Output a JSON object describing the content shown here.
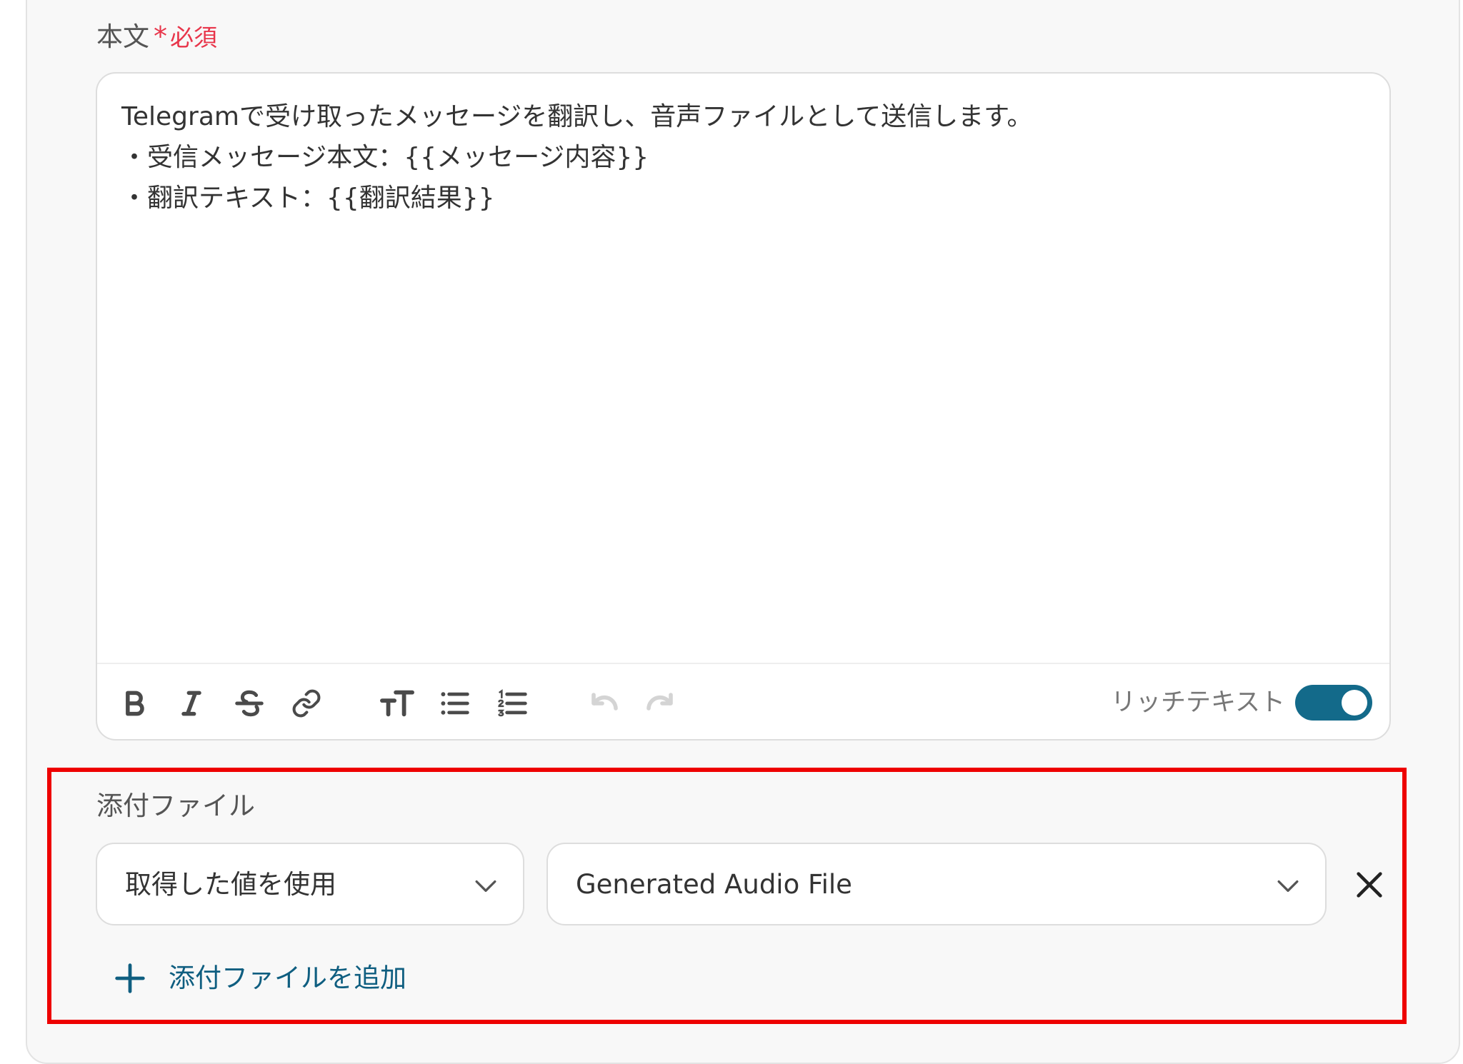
{
  "body_field": {
    "label": "本文",
    "required_mark": "*",
    "required_text": "必須",
    "lines": [
      "Telegramで受け取ったメッセージを翻訳し、音声ファイルとして送信します。",
      "・受信メッセージ本文：{{メッセージ内容}}",
      "・翻訳テキスト：{{翻訳結果}}"
    ]
  },
  "toolbar": {
    "icons": [
      "bold-icon",
      "italic-icon",
      "strikethrough-icon",
      "link-icon",
      "text-size-icon",
      "bullet-list-icon",
      "numbered-list-icon",
      "undo-icon",
      "redo-icon"
    ],
    "rich_text_label": "リッチテキスト",
    "rich_text_enabled": true
  },
  "attachment_field": {
    "label": "添付ファイル",
    "source_select": {
      "value": "取得した値を使用"
    },
    "value_select": {
      "value": "Generated Audio File"
    },
    "add_label": "添付ファイルを追加"
  },
  "colors": {
    "required": "#e8354a",
    "accent": "#136a8a",
    "link": "#0f5e80",
    "highlight_border": "#ee0000",
    "panel_background": "#f8f8f8"
  }
}
